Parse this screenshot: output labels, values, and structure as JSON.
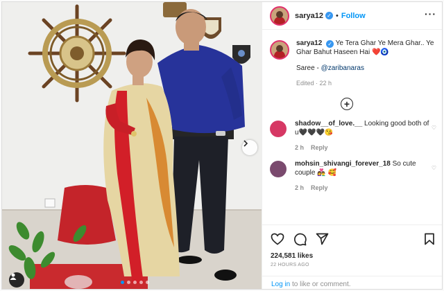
{
  "post": {
    "username": "sarya12",
    "follow_label": "Follow",
    "separator": "•",
    "caption_line": "Ye Tera Ghar Ye Mera Ghar.. Ye Ghar Bahut Haseen Hai",
    "caption_emoji": "❤️🧿",
    "saree_prefix": "Saree - ",
    "saree_link": "@zaribanaras",
    "edited": "Edited · 22 h",
    "likes": "224,581 likes",
    "time_ago": "22 HOURS AGO",
    "login_link": "Log in",
    "login_rest": " to like or comment."
  },
  "comments": [
    {
      "user": "shadow__of_love.__",
      "text": "Looking good both of u🖤🖤🖤😘",
      "time": "2 h",
      "reply": "Reply",
      "avatar_color": "#d63864"
    },
    {
      "user": "mohsin_shivangi_forever_18",
      "text": "So cute couple 👩‍❤️‍👨 🥰",
      "time": "2 h",
      "reply": "Reply",
      "avatar_color": "#7a4a6e"
    }
  ],
  "carousel": {
    "count": 5,
    "active_index": 0
  },
  "icons": {
    "header_more": "more-icon",
    "verified": "verified-badge-icon",
    "add_comment": "plus-circle-icon",
    "like": "heart-icon",
    "comment": "comment-icon",
    "share": "share-icon",
    "save": "bookmark-icon",
    "next": "chevron-right-icon",
    "tag": "user-tag-icon"
  },
  "colors": {
    "accent": "#0095f6",
    "link": "#00376b",
    "muted": "#8e8e8e",
    "border": "#dbdbdb"
  }
}
